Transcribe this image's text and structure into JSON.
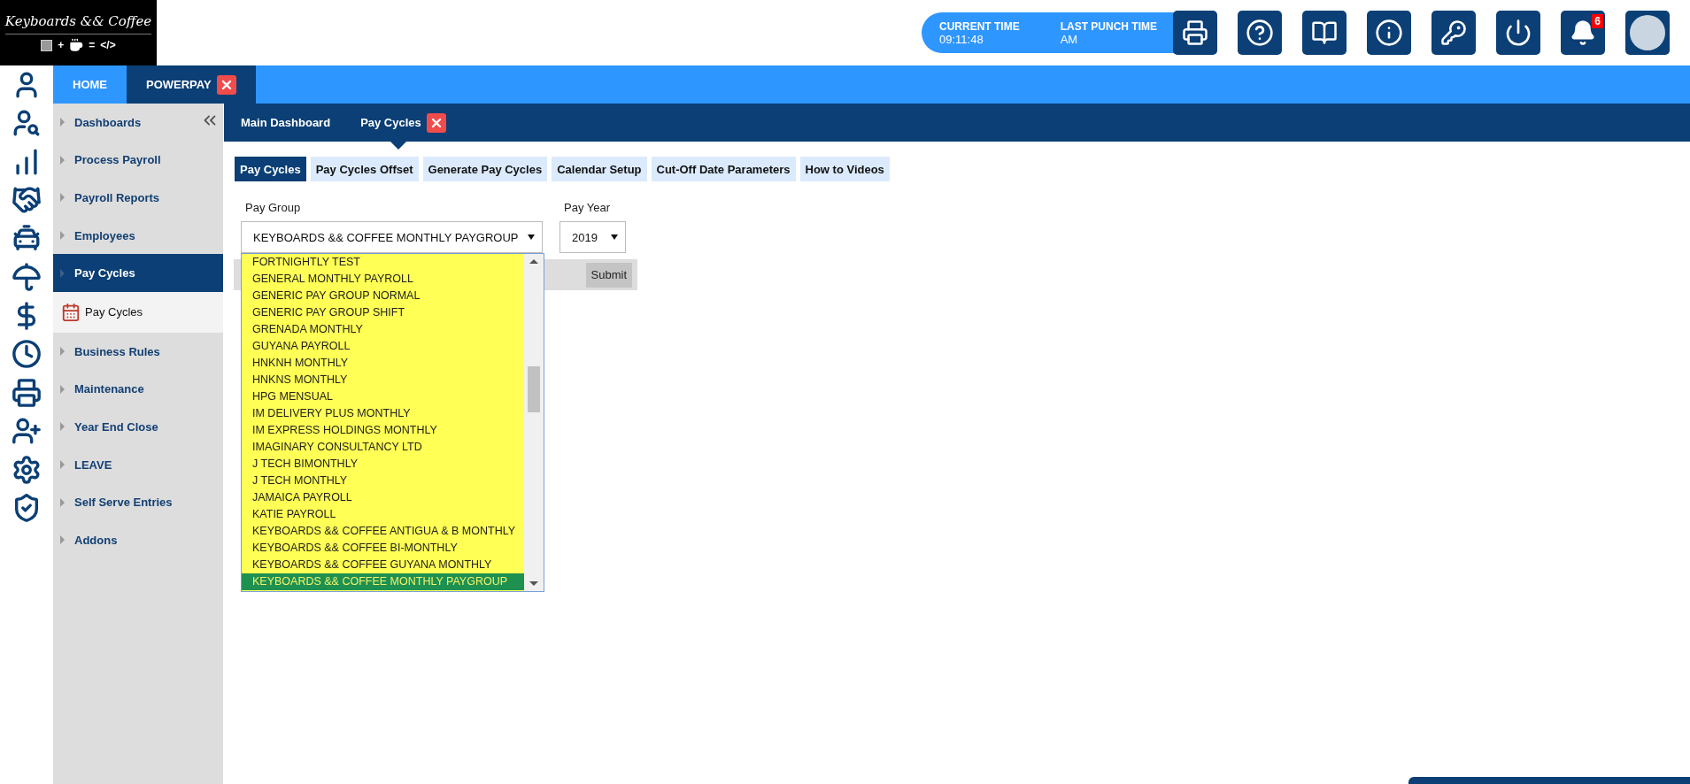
{
  "logo": {
    "title": "Keyboards && Coffee",
    "plus": "+",
    "equals": "=",
    "code": "</>"
  },
  "clock": {
    "current_time_label": "CURRENT TIME",
    "last_punch_label": "LAST PUNCH TIME",
    "current_time": "09:11:48",
    "last_punch": "AM"
  },
  "notifications": {
    "count": "6"
  },
  "main_tabs": [
    {
      "label": "HOME",
      "selected": false,
      "closable": false
    },
    {
      "label": "POWERPAY",
      "selected": true,
      "closable": true
    }
  ],
  "sidebar": {
    "items": [
      {
        "label": "Dashboards",
        "selected": false
      },
      {
        "label": "Process Payroll",
        "selected": false
      },
      {
        "label": "Payroll Reports",
        "selected": false
      },
      {
        "label": "Employees",
        "selected": false
      },
      {
        "label": "Pay Cycles",
        "selected": true,
        "children": [
          {
            "label": "Pay Cycles"
          }
        ]
      },
      {
        "label": "Business Rules",
        "selected": false
      },
      {
        "label": "Maintenance",
        "selected": false
      },
      {
        "label": "Year End Close",
        "selected": false
      },
      {
        "label": "LEAVE",
        "selected": false
      },
      {
        "label": "Self Serve Entries",
        "selected": false
      },
      {
        "label": "Addons",
        "selected": false
      }
    ]
  },
  "page_tabs": [
    {
      "label": "Main Dashboard",
      "selected": false,
      "closable": false
    },
    {
      "label": "Pay Cycles",
      "selected": true,
      "closable": true
    }
  ],
  "sub_tabs": [
    {
      "label": "Pay Cycles",
      "selected": true
    },
    {
      "label": "Pay Cycles Offset",
      "selected": false
    },
    {
      "label": "Generate Pay Cycles",
      "selected": false
    },
    {
      "label": "Calendar Setup",
      "selected": false
    },
    {
      "label": "Cut-Off Date Parameters",
      "selected": false
    },
    {
      "label": "How to Videos",
      "selected": false
    }
  ],
  "form": {
    "pay_group": {
      "label": "Pay Group",
      "value": "KEYBOARDS && COFFEE MONTHLY PAYGROUP",
      "expanded": true,
      "options": [
        {
          "label": "FORTNIGHTLY TEST",
          "selected": false
        },
        {
          "label": "GENERAL MONTHLY PAYROLL",
          "selected": false
        },
        {
          "label": "GENERIC PAY GROUP NORMAL",
          "selected": false
        },
        {
          "label": "GENERIC PAY GROUP SHIFT",
          "selected": false
        },
        {
          "label": "GRENADA MONTHLY",
          "selected": false
        },
        {
          "label": "GUYANA PAYROLL",
          "selected": false
        },
        {
          "label": "HNKNH MONTHLY",
          "selected": false
        },
        {
          "label": "HNKNS MONTHLY",
          "selected": false
        },
        {
          "label": "HPG MENSUAL",
          "selected": false
        },
        {
          "label": "IM DELIVERY PLUS MONTHLY",
          "selected": false
        },
        {
          "label": "IM EXPRESS HOLDINGS MONTHLY",
          "selected": false
        },
        {
          "label": "IMAGINARY CONSULTANCY LTD",
          "selected": false
        },
        {
          "label": "J TECH BIMONTHLY",
          "selected": false
        },
        {
          "label": "J TECH MONTHLY",
          "selected": false
        },
        {
          "label": "JAMAICA PAYROLL",
          "selected": false
        },
        {
          "label": "KATIE PAYROLL",
          "selected": false
        },
        {
          "label": "KEYBOARDS && COFFEE ANTIGUA & B MONTHLY",
          "selected": false
        },
        {
          "label": "KEYBOARDS && COFFEE BI-MONTHLY",
          "selected": false
        },
        {
          "label": "KEYBOARDS && COFFEE GUYANA MONTHLY",
          "selected": false
        },
        {
          "label": "KEYBOARDS && COFFEE MONTHLY PAYGROUP",
          "selected": true
        }
      ]
    },
    "pay_year": {
      "label": "Pay Year",
      "value": "2019"
    },
    "submit": "Submit"
  }
}
